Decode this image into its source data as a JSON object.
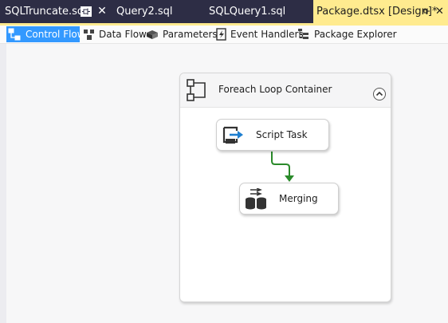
{
  "tabs": [
    {
      "label": "SQLTruncate.sql",
      "active": false
    },
    {
      "label": "Query2.sql",
      "active": false
    },
    {
      "label": "SQLQuery1.sql",
      "active": false
    },
    {
      "label": "Package.dtsx [Design]*",
      "active": true
    }
  ],
  "close_glyph": "✕",
  "toolbar": {
    "items": [
      {
        "label": "Control Flow",
        "icon": "control-flow-icon",
        "active": true
      },
      {
        "label": "Data Flow",
        "icon": "data-flow-icon",
        "active": false
      },
      {
        "label": "Parameters",
        "icon": "parameters-icon",
        "active": false
      },
      {
        "label": "Event Handlers",
        "icon": "event-handlers-icon",
        "active": false
      },
      {
        "label": "Package Explorer",
        "icon": "package-explorer-icon",
        "active": false
      }
    ]
  },
  "designer": {
    "container": {
      "title": "Foreach Loop Container",
      "icon": "foreach-loop-icon",
      "collapse_icon": "chevron-up-icon"
    },
    "tasks": [
      {
        "label": "Script Task",
        "icon": "script-task-icon"
      },
      {
        "label": "Merging",
        "icon": "merge-icon"
      }
    ],
    "connector_color": "#2a8a2a"
  },
  "colors": {
    "tab_bar": "#2d2d45",
    "active_tab": "#ffeb8f",
    "toolbar_active": "#3399ff"
  }
}
